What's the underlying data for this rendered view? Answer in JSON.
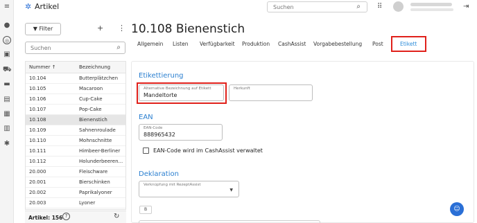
{
  "rail": {
    "icons": [
      "menu-icon",
      "person-icon",
      "article-icon",
      "box-icon",
      "cart-icon",
      "truck-icon",
      "cash-icon",
      "clipboard-icon",
      "chart-icon",
      "gear-icon"
    ]
  },
  "header": {
    "app_title": "Artikel",
    "search_placeholder": "Suchen"
  },
  "list_panel": {
    "filter_label": "Filter",
    "search_placeholder": "Suchen",
    "columns": [
      "Nummer ↑",
      "Bezeichnung"
    ],
    "rows": [
      {
        "nummer": "10.104",
        "bezeichnung": "Butterplätzchen"
      },
      {
        "nummer": "10.105",
        "bezeichnung": "Macaroon"
      },
      {
        "nummer": "10.106",
        "bezeichnung": "Cup-Cake"
      },
      {
        "nummer": "10.107",
        "bezeichnung": "Pop-Cake"
      },
      {
        "nummer": "10.108",
        "bezeichnung": "Bienenstich",
        "selected": true
      },
      {
        "nummer": "10.109",
        "bezeichnung": "Sahnenroulade"
      },
      {
        "nummer": "10.110",
        "bezeichnung": "Mohnschnitte"
      },
      {
        "nummer": "10.111",
        "bezeichnung": "Himbeer-Berliner"
      },
      {
        "nummer": "10.112",
        "bezeichnung": "Holunderbeeren..."
      },
      {
        "nummer": "20.000",
        "bezeichnung": "Fleischware"
      },
      {
        "nummer": "20.001",
        "bezeichnung": "Bierschinken"
      },
      {
        "nummer": "20.002",
        "bezeichnung": "Paprikalyoner"
      },
      {
        "nummer": "20.003",
        "bezeichnung": "Lyoner"
      }
    ],
    "footer_count": "Artikel: 156"
  },
  "detail": {
    "title": "10.108 Bienenstich",
    "tabs": [
      {
        "label": "Allgemein"
      },
      {
        "label": "Listen"
      },
      {
        "label": "Verfügbarkeit"
      },
      {
        "label": "Produktion"
      },
      {
        "label": "CashAssist"
      },
      {
        "label": "Vorgabebestellung"
      },
      {
        "label": "Post"
      },
      {
        "label": "Etikett",
        "active": true
      }
    ],
    "etikettierung": {
      "section_title": "Etikettierung",
      "alt_label": "Alternative Bezeichnung auf Etikett",
      "alt_value": "Mandeltorte",
      "herkunft_label": "Herkunft",
      "herkunft_value": ""
    },
    "ean": {
      "section_title": "EAN",
      "code_label": "EAN-Code",
      "code_value": "888965432",
      "checkbox_label": "EAN-Code wird im CashAssist verwaltet",
      "checkbox_checked": false
    },
    "deklaration": {
      "section_title": "Deklaration",
      "select_label": "Verknüpfung mit RezeptAssist",
      "select_value": "",
      "small_button": "B"
    }
  },
  "colors": {
    "accent": "#2a8bd9",
    "highlight": "#e0201a",
    "selected_row": "#e6e6e6"
  }
}
